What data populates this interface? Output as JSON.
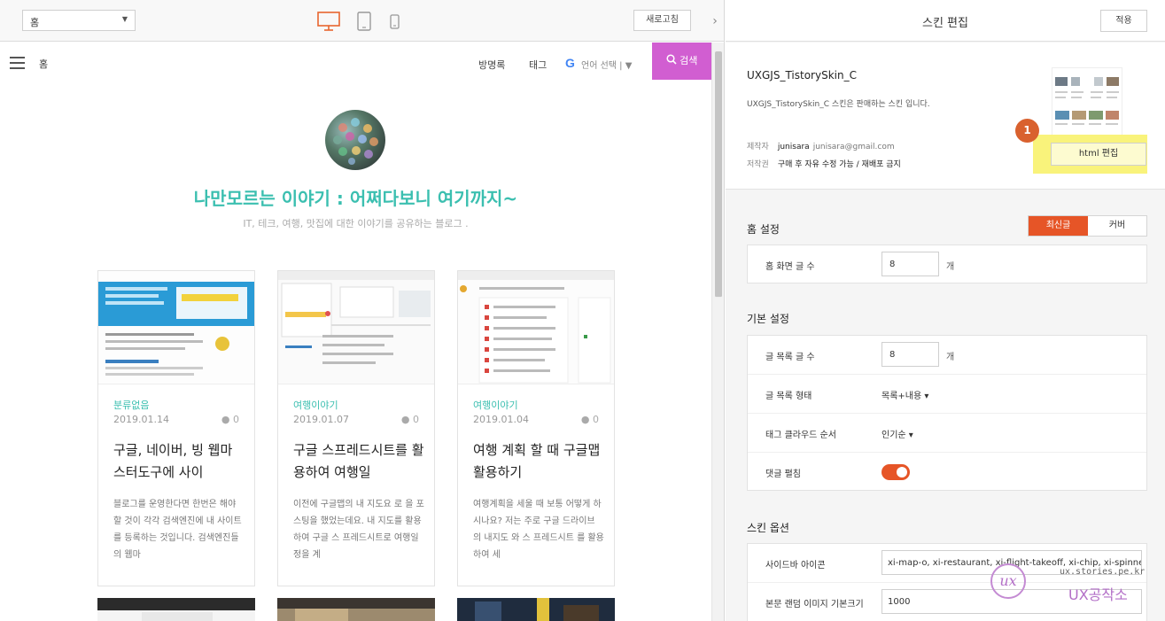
{
  "toolbar": {
    "page_select": "홈",
    "devices": [
      "desktop-icon",
      "tablet-icon",
      "mobile-icon"
    ],
    "reload_label": "새로고침",
    "collapse_icon": "chevron-right-icon"
  },
  "blog": {
    "nav_home": "홈",
    "nav_links": [
      "방명록",
      "태그"
    ],
    "google_logo": "G",
    "lang_label": "언어 선택 | ▼",
    "search_label": "검색",
    "title": "나만모르는 이야기 : 어쩌다보니 여기까지~",
    "description": "IT, 테크, 여행, 맛집에 대한 이야기를 공유하는 블로그 .",
    "accent_color": "#3bbfb0",
    "search_color": "#d15ed1",
    "posts": [
      {
        "category": "분류없음",
        "date": "2019.01.14",
        "comments": "0",
        "title": "구글, 네이버, 빙 웹마스터도구에 사이",
        "excerpt": "블로그를 운영한다면 한번은 해야 할 것이 각각 검색엔진에 내 사이트를 등록하는 것입니다. 검색엔진들의 웹마"
      },
      {
        "category": "여행이야기",
        "date": "2019.01.07",
        "comments": "0",
        "title": "구글 스프레드시트를 활용하여 여행일",
        "excerpt": "이전에 구글맵의 내 지도요 로 을 포스팅을 했었는데요. 내 지도를 활용하여 구글 스 프레드시트로 여행일정을 계"
      },
      {
        "category": "여행이야기",
        "date": "2019.01.04",
        "comments": "0",
        "title": "여행 계획 할 때 구글맵 활용하기",
        "excerpt": "여행계획을 세울 때 보통 어떻게 하시나요? 저는 주로 구글 드라이브 의 내지도 와 스 프레드시트 를 활용하여 세"
      }
    ]
  },
  "editor": {
    "title": "스킨 편집",
    "apply_label": "적용",
    "skin_name": "UXGJS_TistorySkin_C",
    "skin_desc": "UXGJS_TistorySkin_C 스킨은 판매하는 스킨 입니다.",
    "author_label": "제작자",
    "author_name": "junisara",
    "author_email": "junisara@gmail.com",
    "copyright_label": "저작권",
    "copyright_value": "구매 후 자유 수정 가능 / 재배포 금지",
    "badge": "1",
    "html_edit_label": "html 편집",
    "home_settings": {
      "title": "홈 설정",
      "tabs": [
        "최신글",
        "커버"
      ],
      "rows": [
        {
          "label": "홈 화면 글 수",
          "value": "8",
          "unit": "개"
        }
      ]
    },
    "basic_settings": {
      "title": "기본 설정",
      "post_count_label": "글 목록 글 수",
      "post_count_value": "8",
      "post_count_unit": "개",
      "list_type_label": "글 목록 형태",
      "list_type_value": "목록+내용 ▾",
      "tag_order_label": "태그 클라우드 순서",
      "tag_order_value": "인기순 ▾",
      "comment_expand_label": "댓글 펼침",
      "comment_expand_on": true
    },
    "skin_options": {
      "title": "스킨 옵션",
      "sidebar_icon_label": "사이드바 아이콘",
      "sidebar_icon_value": "xi-map-o, xi-restaurant, xi-flight-takeoff, xi-chip, xi-spinner",
      "random_img_label": "본문 랜덤 이미지 기본크기",
      "random_img_value": "1000"
    },
    "accent_color": "#e65527",
    "highlight_color": "#f9f37b"
  },
  "watermark": {
    "url": "ux.stories.pe.kr",
    "name": "UX공작소"
  }
}
